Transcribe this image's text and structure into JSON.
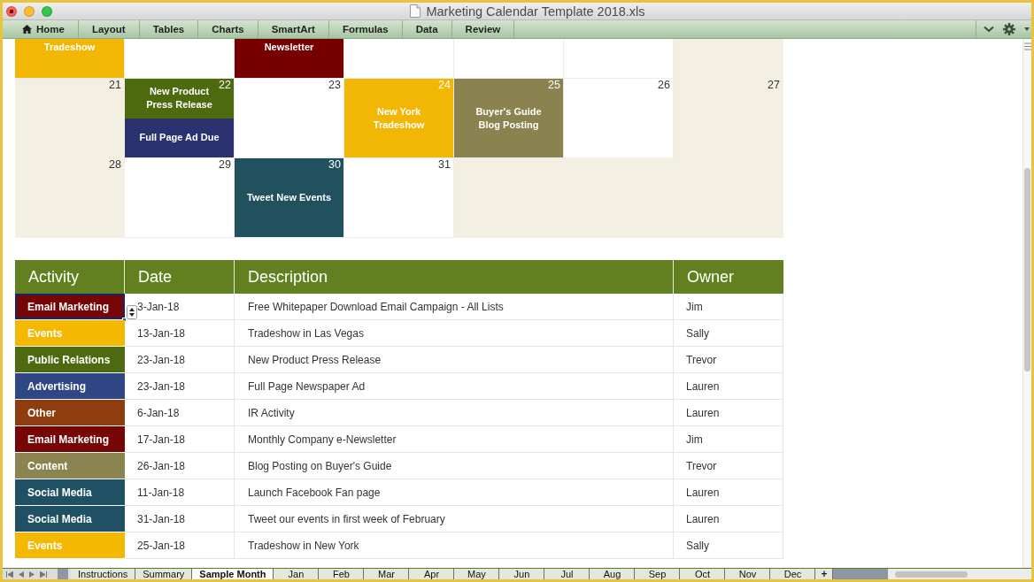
{
  "window": {
    "title": "Marketing Calendar Template 2018.xls"
  },
  "ribbon": {
    "tabs": [
      {
        "label": "Home",
        "kind": "icon",
        "selected": false
      },
      {
        "label": "Layout",
        "kind": "text",
        "selected": false
      },
      {
        "label": "Tables",
        "kind": "text",
        "selected": false
      },
      {
        "label": "Charts",
        "kind": "text",
        "selected": false
      },
      {
        "label": "SmartArt",
        "kind": "text",
        "selected": false
      },
      {
        "label": "Formulas",
        "kind": "text",
        "selected": false
      },
      {
        "label": "Data",
        "kind": "text",
        "selected": false
      },
      {
        "label": "Review",
        "kind": "text",
        "selected": false
      }
    ]
  },
  "calendar": {
    "weeks": [
      {
        "days": [
          {
            "events": [
              {
                "label": "Tradeshow",
                "color": "#f2b705"
              }
            ]
          },
          {
            "shaded": false
          },
          {
            "events": [
              {
                "label": "Newsletter",
                "color": "#760000"
              }
            ]
          },
          {
            "shaded": false
          },
          {
            "shaded": false
          },
          {
            "shaded": false
          },
          {
            "shaded": true
          }
        ]
      },
      {
        "days": [
          {
            "number": "21",
            "shaded": true
          },
          {
            "number": "22",
            "events": [
              {
                "label": "New Product\nPress Release",
                "color": "#4e6a0f"
              },
              {
                "label": "Full Page Ad Due",
                "color": "#2a3270"
              }
            ]
          },
          {
            "number": "23",
            "shaded": false
          },
          {
            "number": "24",
            "events": [
              {
                "label": "New York\nTradeshow",
                "color": "#f2b705"
              }
            ]
          },
          {
            "number": "25",
            "events": [
              {
                "label": "Buyer's Guide\nBlog Posting",
                "color": "#8a834f"
              }
            ]
          },
          {
            "number": "26",
            "shaded": false
          },
          {
            "number": "27",
            "shaded": true
          }
        ]
      },
      {
        "days": [
          {
            "number": "28",
            "shaded": true
          },
          {
            "number": "29",
            "shaded": false
          },
          {
            "number": "30",
            "events": [
              {
                "label": "Tweet New Events",
                "color": "#21505f"
              }
            ]
          },
          {
            "number": "31",
            "shaded": false
          },
          {
            "shaded": true
          },
          {
            "shaded": true
          },
          {
            "shaded": true
          }
        ]
      }
    ]
  },
  "table": {
    "columns": [
      "Activity",
      "Date",
      "Description",
      "Owner"
    ],
    "rows": [
      {
        "activity": "Email Marketing",
        "color": "#760606",
        "date": "3-Jan-18",
        "description": "Free Whitepaper Download Email Campaign - All Lists",
        "owner": "Jim",
        "selected": true
      },
      {
        "activity": "Events",
        "color": "#f5b800",
        "date": "13-Jan-18",
        "description": "Tradeshow in Las Vegas",
        "owner": "Sally",
        "selected": false
      },
      {
        "activity": "Public Relations",
        "color": "#4e6a10",
        "date": "23-Jan-18",
        "description": "New Product Press Release",
        "owner": "Trevor",
        "selected": false
      },
      {
        "activity": "Advertising",
        "color": "#304785",
        "date": "23-Jan-18",
        "description": "Full Page Newspaper Ad",
        "owner": "Lauren",
        "selected": false
      },
      {
        "activity": "Other",
        "color": "#8f3d0e",
        "date": "6-Jan-18",
        "description": "IR Activity",
        "owner": "Lauren",
        "selected": false
      },
      {
        "activity": "Email Marketing",
        "color": "#760606",
        "date": "17-Jan-18",
        "description": "Monthly Company e-Newsletter",
        "owner": "Jim",
        "selected": false
      },
      {
        "activity": "Content",
        "color": "#8b8451",
        "date": "26-Jan-18",
        "description": "Blog Posting on Buyer's Guide",
        "owner": "Trevor",
        "selected": false
      },
      {
        "activity": "Social Media",
        "color": "#1f5064",
        "date": "11-Jan-18",
        "description": "Launch Facebook Fan page",
        "owner": "Lauren",
        "selected": false
      },
      {
        "activity": "Social Media",
        "color": "#1f5064",
        "date": "31-Jan-18",
        "description": "Tweet our events in first week of February",
        "owner": "Lauren",
        "selected": false
      },
      {
        "activity": "Events",
        "color": "#f5b800",
        "date": "25-Jan-18",
        "description": "Tradeshow in New York",
        "owner": "Sally",
        "selected": false
      }
    ]
  },
  "sheet_tabs": [
    {
      "label": "Instructions",
      "selected": false
    },
    {
      "label": "Summary",
      "selected": false
    },
    {
      "label": "Sample Month",
      "selected": true
    },
    {
      "label": "Jan",
      "selected": false
    },
    {
      "label": "Feb",
      "selected": false
    },
    {
      "label": "Mar",
      "selected": false
    },
    {
      "label": "Apr",
      "selected": false
    },
    {
      "label": "May",
      "selected": false
    },
    {
      "label": "Jun",
      "selected": false
    },
    {
      "label": "Jul",
      "selected": false
    },
    {
      "label": "Aug",
      "selected": false
    },
    {
      "label": "Sep",
      "selected": false
    },
    {
      "label": "Oct",
      "selected": false
    },
    {
      "label": "Nov",
      "selected": false
    },
    {
      "label": "Dec",
      "selected": false
    }
  ],
  "add_sheet_button": {
    "label": "+"
  }
}
